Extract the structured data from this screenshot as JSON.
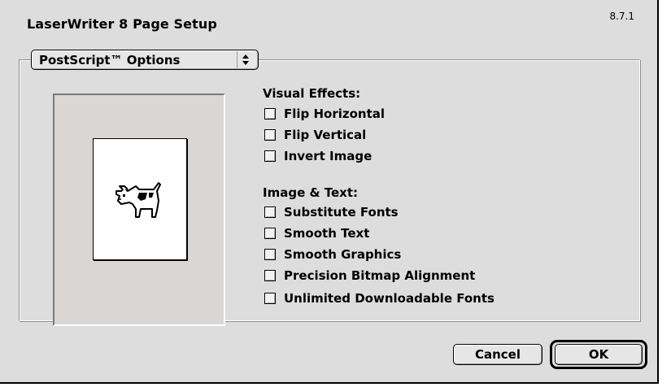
{
  "dialog": {
    "title": "LaserWriter 8 Page Setup",
    "version": "8.7.1"
  },
  "popup": {
    "selected": "PostScript™ Options",
    "icon": "up-down-arrows-icon"
  },
  "preview": {
    "icon": "dogcow-icon"
  },
  "visual_effects": {
    "label": "Visual Effects:",
    "options": [
      {
        "label": "Flip Horizontal",
        "checked": false
      },
      {
        "label": "Flip Vertical",
        "checked": false
      },
      {
        "label": "Invert Image",
        "checked": false
      }
    ]
  },
  "image_text": {
    "label": "Image & Text:",
    "options": [
      {
        "label": "Substitute Fonts",
        "checked": false
      },
      {
        "label": "Smooth Text",
        "checked": false
      },
      {
        "label": "Smooth Graphics",
        "checked": false
      },
      {
        "label": "Precision Bitmap Alignment",
        "checked": false
      },
      {
        "label": "Unlimited Downloadable Fonts",
        "checked": false
      }
    ]
  },
  "buttons": {
    "cancel": "Cancel",
    "ok": "OK"
  },
  "colors": {
    "dialog_background": "#dddddd",
    "preview_background": "#d9d6d4",
    "paper": "#ffffff"
  }
}
